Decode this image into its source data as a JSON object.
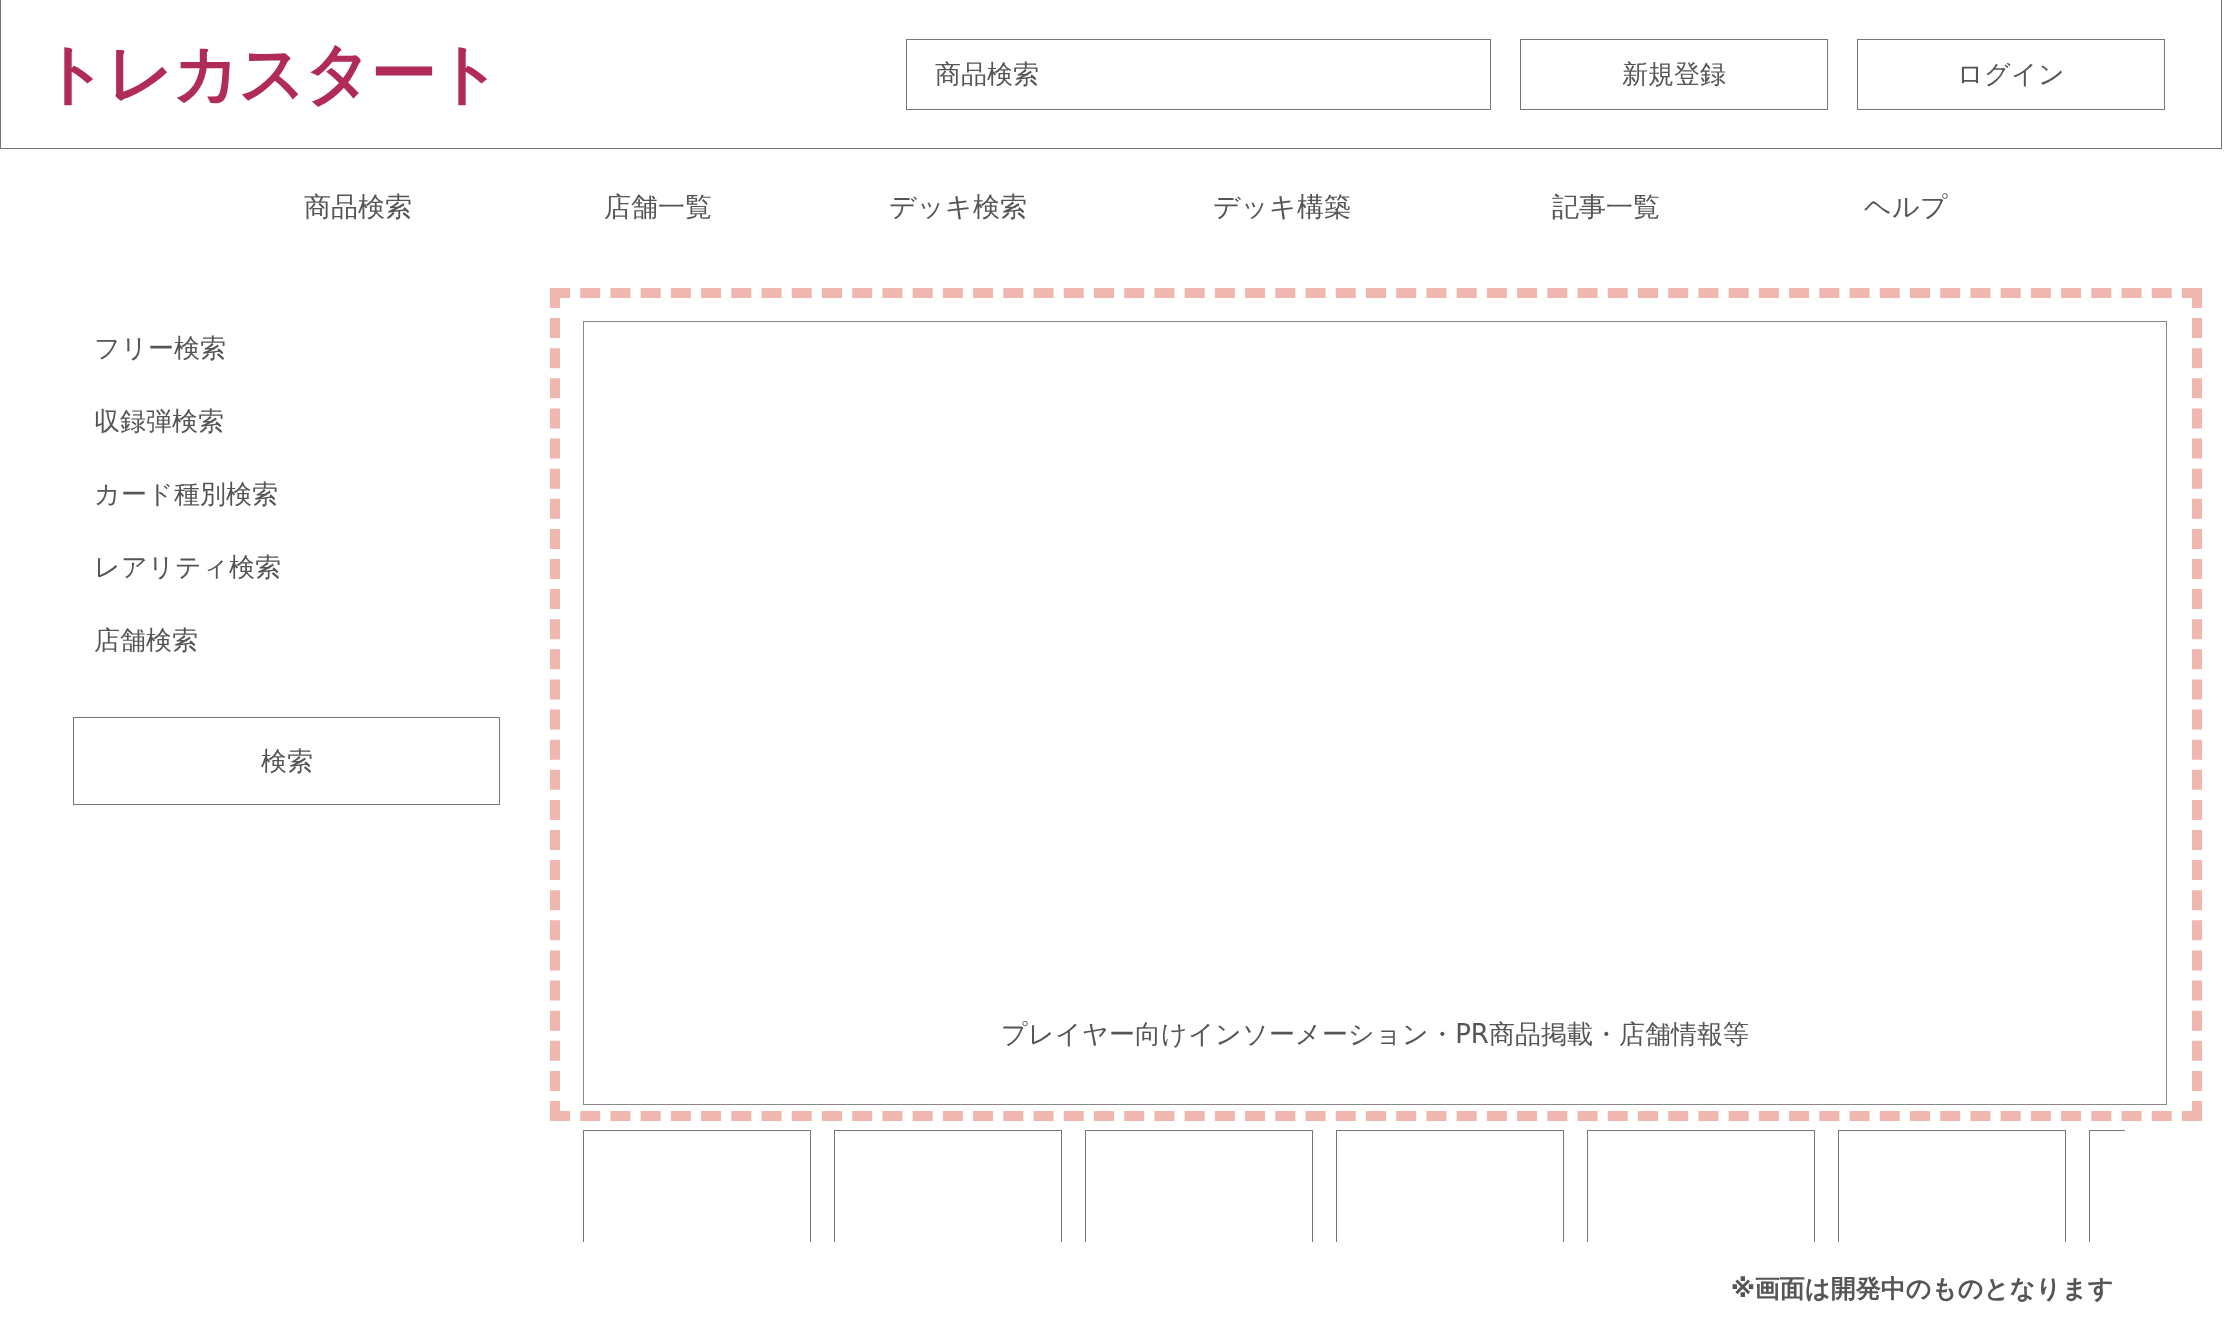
{
  "header": {
    "logo": "トレカスタート",
    "search": {
      "placeholder": "商品検索"
    },
    "buttons": [
      "新規登録",
      "ログイン"
    ]
  },
  "nav": [
    "商品検索",
    "店舗一覧",
    "デッキ検索",
    "デッキ構築",
    "記事一覧",
    "ヘルプ"
  ],
  "sidebar": {
    "items": [
      "フリー検索",
      "収録弾検索",
      "カード種別検索",
      "レアリティ検索",
      "店舗検索"
    ],
    "button": "検索"
  },
  "banner": {
    "text": "プレイヤー向けインソーメーション・PR商品掲載・店舗情報等"
  },
  "cards": [
    {
      "kind": "empty"
    },
    {
      "kind": "empty"
    },
    {
      "kind": "empty"
    },
    {
      "kind": "empty"
    },
    {
      "kind": "empty"
    },
    {
      "kind": "empty"
    },
    {
      "kind": "empty"
    }
  ],
  "footnote": "※画面は開発中のものとなります"
}
